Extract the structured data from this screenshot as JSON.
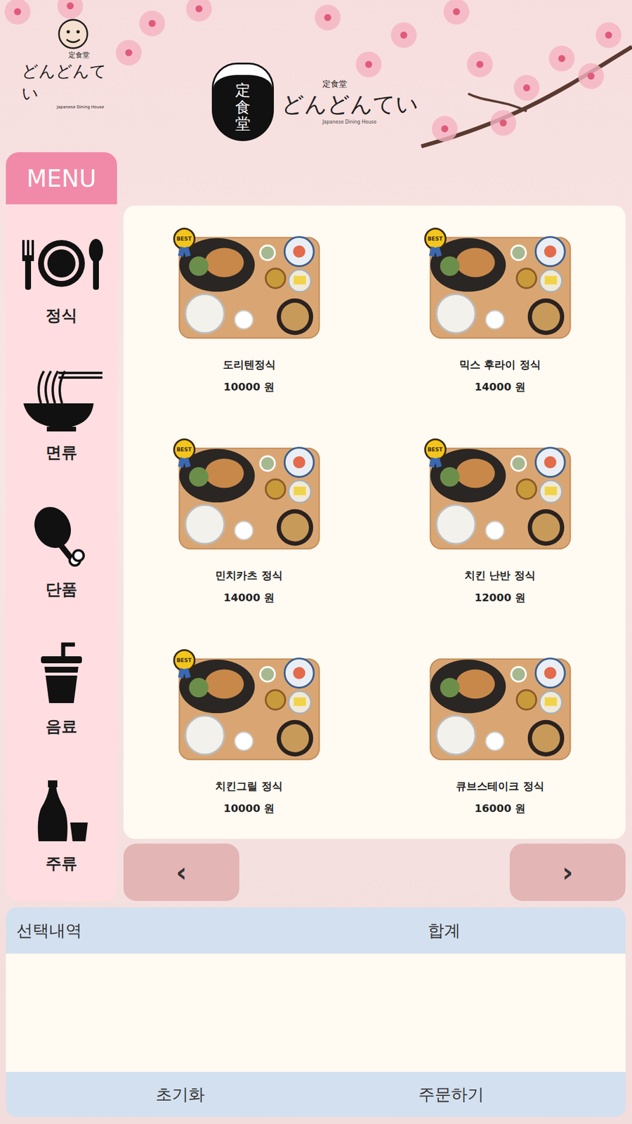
{
  "brand": {
    "emblem": "定食堂",
    "small": "定食堂",
    "name": "どんどんてい",
    "tagline": "Japanese Dining House"
  },
  "sidebar": {
    "title": "MENU",
    "items": [
      {
        "label": "정식",
        "kind": "meal"
      },
      {
        "label": "면류",
        "kind": "noodle"
      },
      {
        "label": "단품",
        "kind": "single"
      },
      {
        "label": "음료",
        "kind": "drink"
      },
      {
        "label": "주류",
        "kind": "liquor"
      }
    ]
  },
  "menu": {
    "badge_label": "BEST",
    "items": [
      {
        "name": "도리텐정식",
        "price": "10000 원",
        "best": true
      },
      {
        "name": "믹스 후라이 정식",
        "price": "14000 원",
        "best": true
      },
      {
        "name": "민치카츠 정식",
        "price": "14000 원",
        "best": true
      },
      {
        "name": "치킨 난반 정식",
        "price": "12000 원",
        "best": true
      },
      {
        "name": "치킨그릴 정식",
        "price": "10000 원",
        "best": true
      },
      {
        "name": "큐브스테이크 정식",
        "price": "16000 원",
        "best": false
      }
    ]
  },
  "pager": {
    "prev": "‹",
    "next": "›"
  },
  "order": {
    "title": "선택내역",
    "total_label": "합계",
    "items": [],
    "reset": "초기화",
    "submit": "주문하기"
  }
}
